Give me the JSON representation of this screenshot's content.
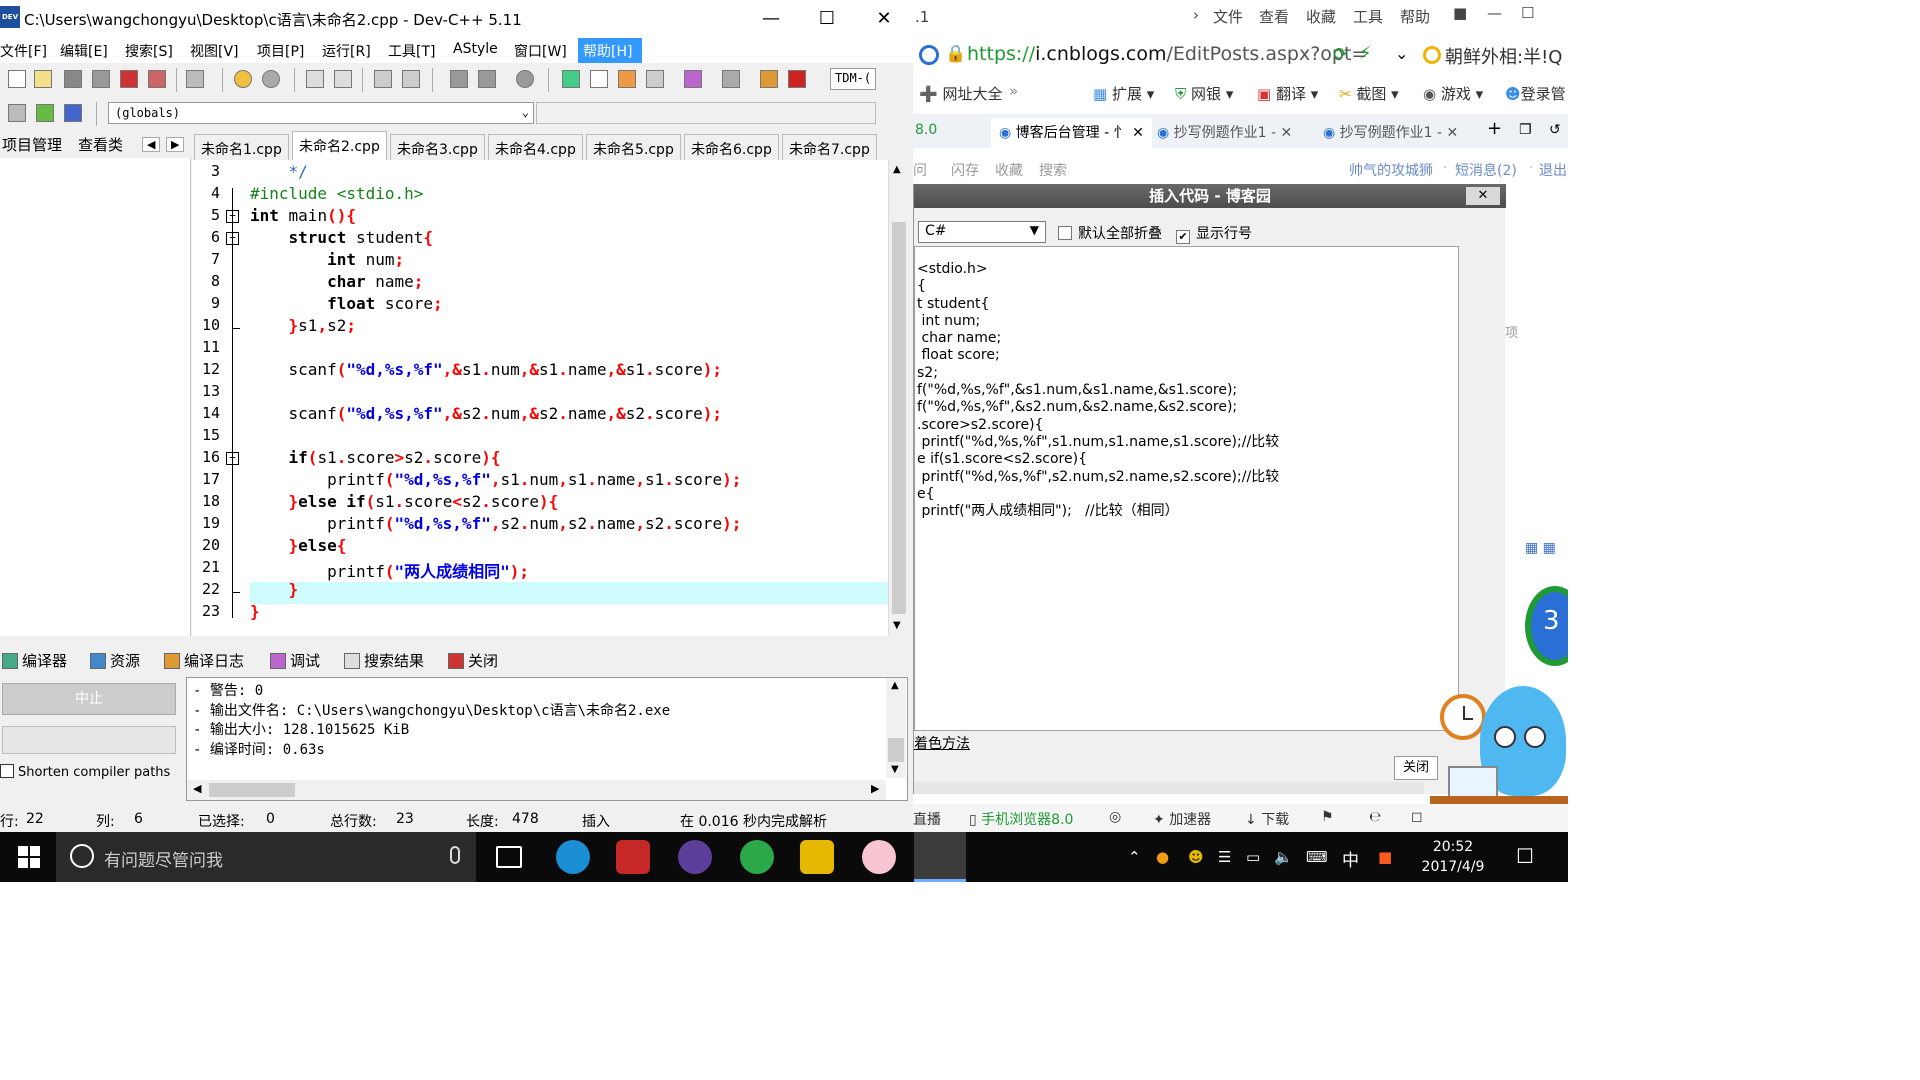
{
  "devcpp": {
    "title": "C:\\Users\\wangchongyu\\Desktop\\c语言\\未命名2.cpp - Dev-C++ 5.11",
    "menu": [
      "文件[F]",
      "编辑[E]",
      "搜索[S]",
      "视图[V]",
      "项目[P]",
      "运行[R]",
      "工具[T]",
      "AStyle",
      "窗口[W]",
      "帮助[H]"
    ],
    "compiler_combo": "TDM-(",
    "scope_combo": "(globals)",
    "left_tabs": [
      "项目管理",
      "查看类"
    ],
    "file_tabs": [
      "未命名1.cpp",
      "未命名2.cpp",
      "未命名3.cpp",
      "未命名4.cpp",
      "未命名5.cpp",
      "未命名6.cpp",
      "未命名7.cpp"
    ],
    "active_tab": "未命名2.cpp",
    "line_numbers": [
      "3",
      "4",
      "5",
      "6",
      "7",
      "8",
      "9",
      "10",
      "11",
      "12",
      "13",
      "14",
      "15",
      "16",
      "17",
      "18",
      "19",
      "20",
      "21",
      "22",
      "23"
    ],
    "bottom_tabs": [
      "编译器",
      "资源",
      "编译日志",
      "调试",
      "搜索结果",
      "关闭"
    ],
    "stop_button": "中止",
    "shorten_paths": "Shorten compiler paths",
    "log": [
      "- 警告: 0",
      "- 输出文件名: C:\\Users\\wangchongyu\\Desktop\\c语言\\未命名2.exe",
      "- 输出大小: 128.1015625 KiB",
      "- 编译时间: 0.63s"
    ],
    "status": {
      "row_label": "行:",
      "row_value": "22",
      "col_label": "列:",
      "col_value": "6",
      "sel_label": "已选择:",
      "sel_value": "0",
      "total_label": "总行数:",
      "total_value": "23",
      "len_label": "长度:",
      "len_value": "478",
      "mode": "插入",
      "parse": "在 0.016 秒内完成解析"
    }
  },
  "browser": {
    "title_fragment": ".1",
    "menu": [
      "文件",
      "查看",
      "收藏",
      "工具",
      "帮助"
    ],
    "url_proto": "https://",
    "url_host": "i.cnblogs.com",
    "url_path": "/EditPosts.aspx?opt=",
    "search_text": "朝鲜外相:半!Q",
    "bookmarks": [
      "网址大全",
      "扩展",
      "网银",
      "翻译",
      "截图",
      "游戏",
      "登录管"
    ],
    "tab_fragment": "8.0",
    "tabs": [
      "博客后台管理 - 忄",
      "抄写例题作业1 -",
      "抄写例题作业1 -"
    ],
    "nav": [
      "博问",
      "闪存",
      "收藏",
      "搜索"
    ],
    "user": "帅气的攻城狮",
    "messages": "短消息(2)",
    "logout": "退出",
    "status": [
      "直播",
      "手机浏览器8.0",
      "加速器",
      "下载"
    ]
  },
  "dialog": {
    "title": "插入代码 - 博客园",
    "close_x": "✕",
    "language": "C#",
    "collapse_all": "默认全部折叠",
    "show_line_numbers": "显示行号",
    "code_lines": [
      "<stdio.h>",
      "{",
      "t student{",
      " int num;",
      " char name;",
      " float score;",
      "s2;",
      "",
      "f(\"%d,%s,%f\",&s1.num,&s1.name,&s1.score);",
      "",
      "f(\"%d,%s,%f\",&s2.num,&s2.name,&s2.score);",
      "",
      ".score>s2.score){",
      " printf(\"%d,%s,%f\",s1.num,s1.name,s1.score);//比较",
      "e if(s1.score<s2.score){",
      " printf(\"%d,%s,%f\",s2.num,s2.name,s2.score);//比较",
      "e{",
      " printf(\"两人成绩相同\");   //比较（相同）"
    ],
    "color_method": "着色方法",
    "close_button": "关闭",
    "side_label": "项",
    "side_number": "3"
  },
  "taskbar": {
    "search_placeholder": "有问题尽管问我",
    "ime": "中",
    "time": "20:52",
    "date": "2017/4/9",
    "mascot_label": "中"
  },
  "colors": {
    "highlight": "#cffcff",
    "keyword_red": "#ff0000",
    "string_blue": "#0000e6",
    "comment": "#2d6fb3",
    "preprocessor": "#16801a",
    "menu_active": "#3399ff",
    "url_green": "#1f9a34"
  },
  "icons": [
    "dev-cpp-icon",
    "new-file-icon",
    "open-file-icon",
    "save-icon",
    "save-all-icon",
    "close-file-icon",
    "print-icon",
    "undo-icon",
    "redo-icon",
    "find-icon",
    "replace-icon",
    "indent-icon",
    "unindent-icon",
    "compile-icon",
    "run-icon",
    "compile-run-icon",
    "rebuild-icon",
    "check-icon",
    "stop-icon",
    "chart-icon",
    "debug-icon"
  ]
}
